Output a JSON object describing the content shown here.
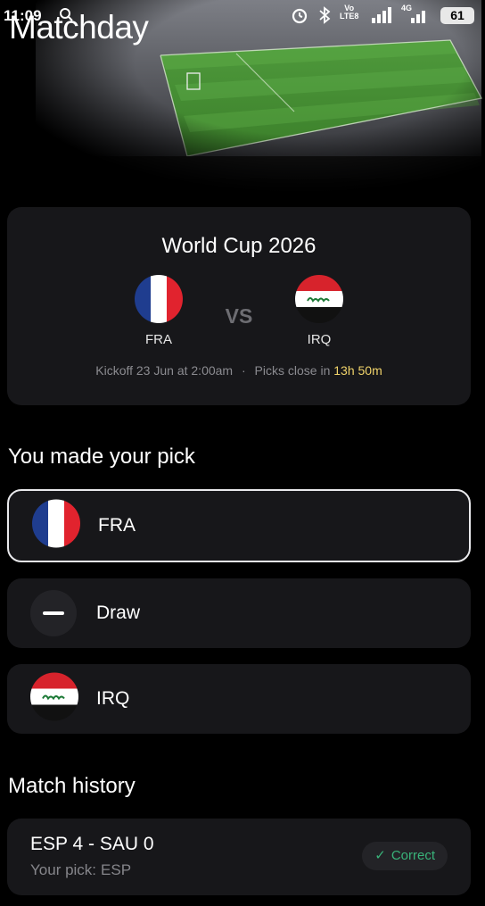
{
  "status_bar": {
    "time": "11:09",
    "network_label_top": "Vo",
    "network_label_bottom": "LTE8",
    "signal_label": "4G",
    "battery": "61"
  },
  "app": {
    "title": "Matchday"
  },
  "match": {
    "competition": "World Cup 2026",
    "home": {
      "code": "FRA",
      "flag": "france-flag"
    },
    "away": {
      "code": "IRQ",
      "flag": "iraq-flag"
    },
    "vs": "VS",
    "kickoff": "Kickoff 23 Jun at 2:00am",
    "separator": "·",
    "picks_close_label": "Picks close in",
    "picks_close_value": "13h 50m"
  },
  "picks": {
    "title": "You made your pick",
    "options": [
      {
        "label": "FRA",
        "icon": "france-flag",
        "selected": true
      },
      {
        "label": "Draw",
        "icon": "minus-icon",
        "selected": false
      },
      {
        "label": "IRQ",
        "icon": "iraq-flag",
        "selected": false
      }
    ]
  },
  "history": {
    "title": "Match history",
    "items": [
      {
        "score": "ESP 4 - SAU 0",
        "pick_label": "Your pick:",
        "pick_value": "ESP",
        "result_icon": "check-icon",
        "result": "Correct"
      }
    ]
  },
  "colors": {
    "background": "#000000",
    "card": "#17171a",
    "countdown": "#f0d36a",
    "correct": "#39b37a",
    "muted_text": "#8b8b90"
  }
}
